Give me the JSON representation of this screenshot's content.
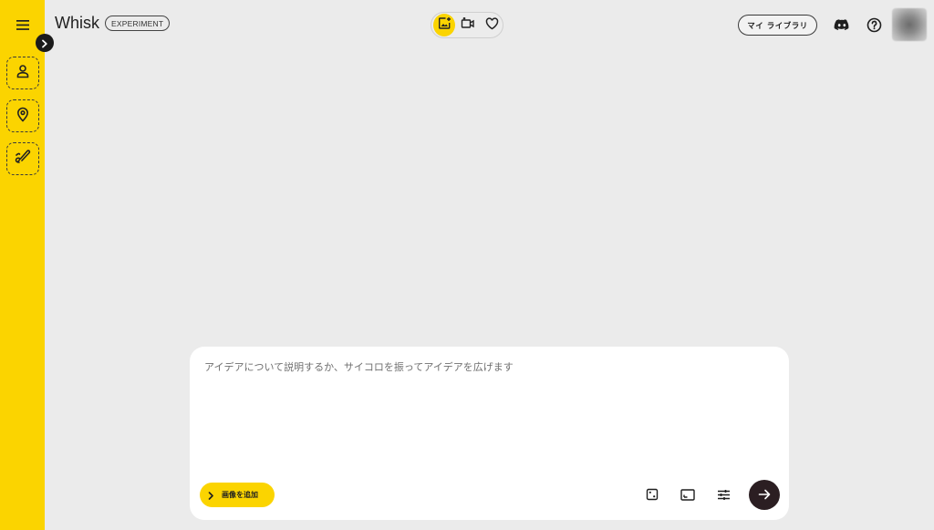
{
  "app": {
    "title": "Whisk",
    "badge": "EXPERIMENT"
  },
  "sidebar": {
    "menu_icon": "hamburger-menu-icon",
    "expand_icon": "chevron-right-icon",
    "slots": [
      {
        "name": "subject-slot",
        "icon": "person-icon"
      },
      {
        "name": "scene-slot",
        "icon": "location-pin-icon"
      },
      {
        "name": "style-slot",
        "icon": "brush-icon"
      }
    ]
  },
  "header": {
    "modes": [
      {
        "name": "image-mode",
        "icon": "add-image-icon",
        "active": true
      },
      {
        "name": "video-mode",
        "icon": "video-icon",
        "active": false
      },
      {
        "name": "favorites-mode",
        "icon": "heart-icon",
        "active": false
      }
    ],
    "library_label": "マイ ライブラリ",
    "discord_icon": "discord-icon",
    "help_icon": "help-icon"
  },
  "composer": {
    "placeholder": "アイデアについて説明するか、サイコロを振ってアイデアを広げます",
    "value": "",
    "add_image_label": "画像を追加",
    "tools": [
      "dice-icon",
      "aspect-ratio-icon",
      "settings-sliders-icon"
    ],
    "send_icon": "arrow-right-icon"
  },
  "colors": {
    "accent_yellow": "#fbd400",
    "background": "#ebebeb",
    "send_button": "#2b1e22"
  }
}
